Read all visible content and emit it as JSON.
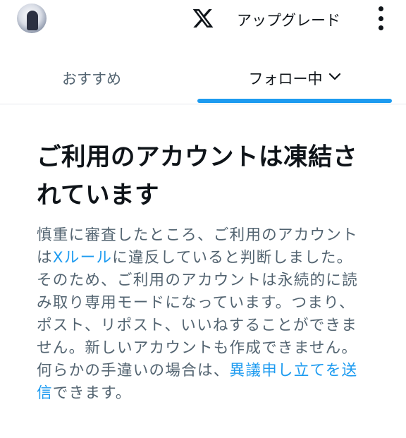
{
  "header": {
    "avatar_icon": "user-avatar",
    "logo_icon": "x-logo-icon",
    "upgrade_label": "アップグレード",
    "more_icon": "more-vertical-icon"
  },
  "tabs": [
    {
      "label": "おすすめ",
      "selected": false
    },
    {
      "label": "フォロー中",
      "selected": true,
      "icon": "chevron-down-icon"
    }
  ],
  "notice": {
    "title": "ご利用のアカウントは凍結されています",
    "body_part1": "慎重に審査したところ、ご利用のアカウントは",
    "rules_link": "Xルール",
    "body_part2": "に違反していると判断しました。そのため、ご利用のアカウントは永続的に読み取り専用モードになっています。つまり、ポスト、リポスト、いいねすることができません。新しいアカウントも作成できません。何らかの手違いの場合は、",
    "appeal_link": "異議申し立てを送信",
    "body_part3": "できます。"
  },
  "colors": {
    "accent": "#1d9bf0",
    "text_primary": "#0f1419",
    "text_secondary": "#536471",
    "divider": "#e6e9ec"
  }
}
